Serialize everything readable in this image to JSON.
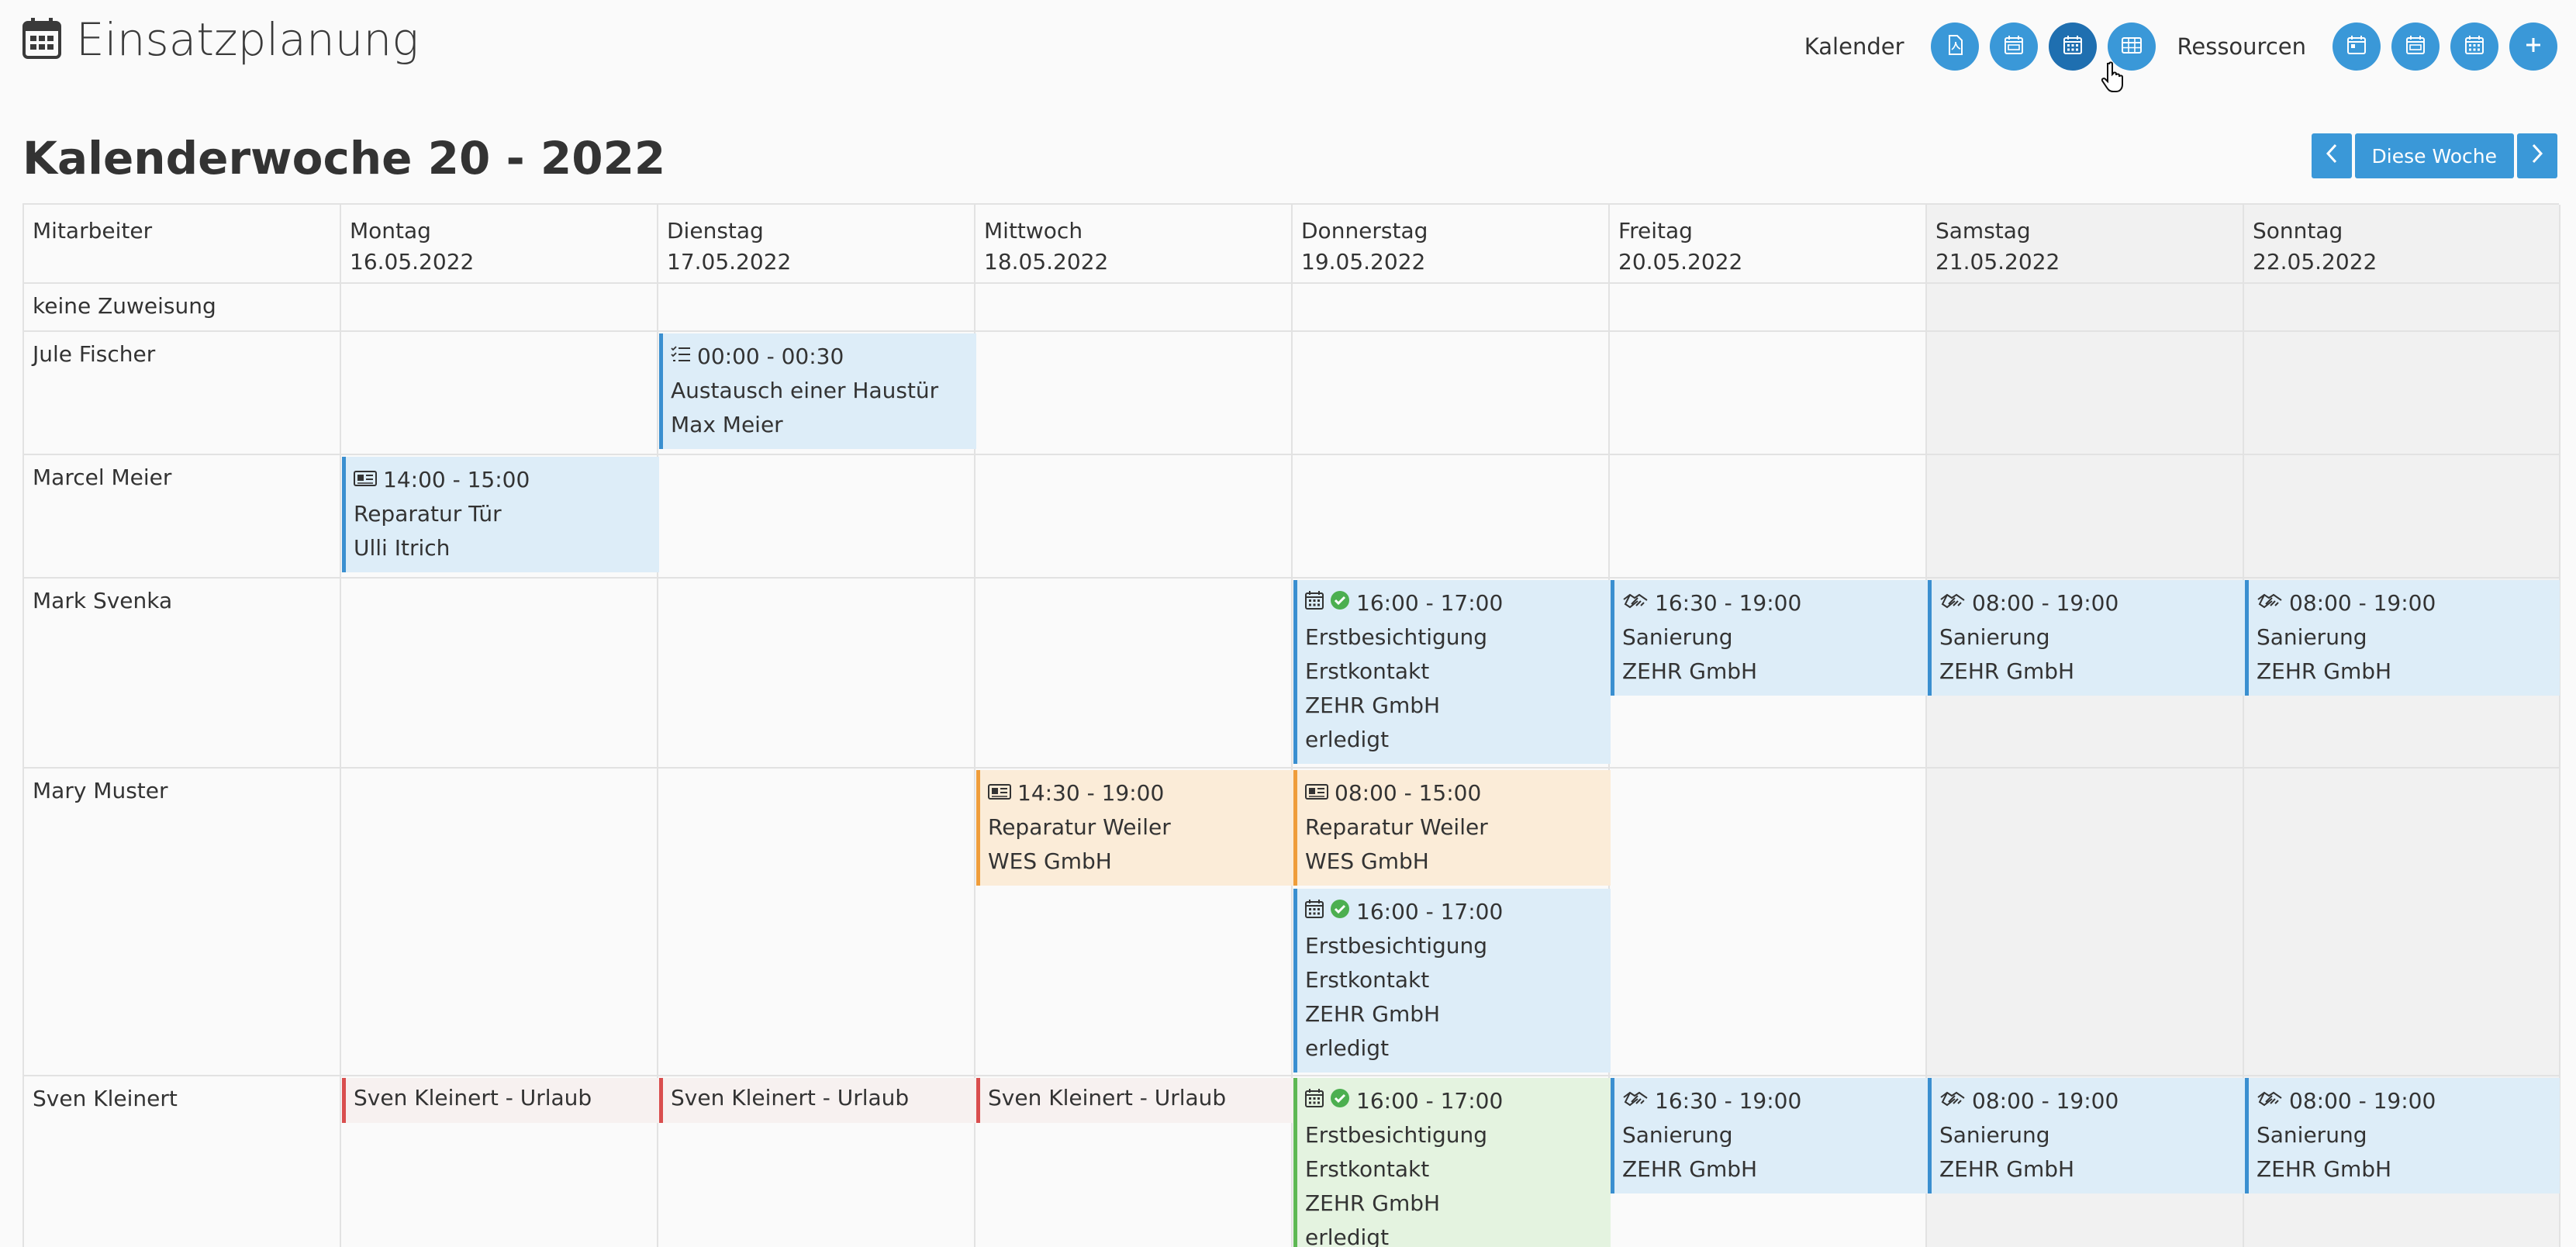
{
  "app": {
    "title": "Einsatzplanung",
    "icon": "calendar-icon"
  },
  "toolbar": {
    "kalender_label": "Kalender",
    "ressourcen_label": "Ressourcen",
    "kalender_buttons": [
      "pdf-icon",
      "calendar-week-icon",
      "calendar-month-icon",
      "table-icon"
    ],
    "ressourcen_buttons": [
      "calendar-day-icon",
      "calendar-week-icon",
      "calendar-month-icon",
      "plus-icon"
    ]
  },
  "week": {
    "title": "Kalenderwoche 20 - 2022",
    "prev_icon": "chevron-left-icon",
    "today_label": "Diese Woche",
    "next_icon": "chevron-right-icon"
  },
  "grid": {
    "employee_header": "Mitarbeiter",
    "days": [
      {
        "name": "Montag",
        "date": "16.05.2022"
      },
      {
        "name": "Dienstag",
        "date": "17.05.2022"
      },
      {
        "name": "Mittwoch",
        "date": "18.05.2022"
      },
      {
        "name": "Donnerstag",
        "date": "19.05.2022"
      },
      {
        "name": "Freitag",
        "date": "20.05.2022"
      },
      {
        "name": "Samstag",
        "date": "21.05.2022"
      },
      {
        "name": "Sonntag",
        "date": "22.05.2022"
      }
    ],
    "rows": [
      "keine Zuweisung",
      "Jule Fischer",
      "Marcel Meier",
      "Mark Svenka",
      "Mary Muster",
      "Sven Kleinert"
    ]
  },
  "events": {
    "jule_di": {
      "time": "00:00 - 00:30",
      "l1": "Austausch einer Haustür",
      "l2": "Max Meier"
    },
    "marcel_mo": {
      "time": "14:00 - 15:00",
      "l1": "Reparatur Tür",
      "l2": "Ulli Itrich"
    },
    "mark_do": {
      "time": "16:00 - 17:00",
      "l1": "Erstbesichtigung",
      "l2": "Erstkontakt",
      "l3": "ZEHR GmbH",
      "l4": "erledigt"
    },
    "mark_fr": {
      "time": "16:30 - 19:00",
      "l1": "Sanierung",
      "l2": "ZEHR GmbH"
    },
    "mark_sa": {
      "time": "08:00 - 19:00",
      "l1": "Sanierung",
      "l2": "ZEHR GmbH"
    },
    "mark_so": {
      "time": "08:00 - 19:00",
      "l1": "Sanierung",
      "l2": "ZEHR GmbH"
    },
    "mary_mi": {
      "time": "14:30 - 19:00",
      "l1": "Reparatur Weiler",
      "l2": "WES GmbH"
    },
    "mary_do1": {
      "time": "08:00 - 15:00",
      "l1": "Reparatur Weiler",
      "l2": "WES GmbH"
    },
    "mary_do2": {
      "time": "16:00 - 17:00",
      "l1": "Erstbesichtigung",
      "l2": "Erstkontakt",
      "l3": "ZEHR GmbH",
      "l4": "erledigt"
    },
    "sven_mo": {
      "l1": "Sven Kleinert - Urlaub"
    },
    "sven_di": {
      "l1": "Sven Kleinert - Urlaub"
    },
    "sven_mi": {
      "l1": "Sven Kleinert - Urlaub"
    },
    "sven_do": {
      "time": "16:00 - 17:00",
      "l1": "Erstbesichtigung",
      "l2": "Erstkontakt",
      "l3": "ZEHR GmbH",
      "l4": "erledigt"
    },
    "sven_fr": {
      "time": "16:30 - 19:00",
      "l1": "Sanierung",
      "l2": "ZEHR GmbH"
    },
    "sven_sa": {
      "time": "08:00 - 19:00",
      "l1": "Sanierung",
      "l2": "ZEHR GmbH"
    },
    "sven_so": {
      "time": "08:00 - 19:00",
      "l1": "Sanierung",
      "l2": "ZEHR GmbH"
    }
  },
  "colors": {
    "accent": "#3a98d8",
    "event_blue": "#ddedf8",
    "event_orange": "#fbecd8",
    "event_green": "#e4f3e0",
    "leave_red": "#d94e4e"
  }
}
